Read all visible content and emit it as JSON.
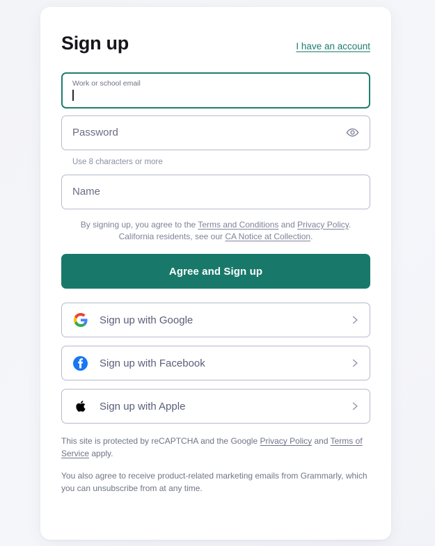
{
  "theme": {
    "accent_green": "#18796b",
    "link_green": "#1d7d6d",
    "page_bg": "#f4f5f9",
    "card_bg": "#ffffff",
    "border": "#b6b9cd",
    "google_red": "#ea4335",
    "google_blue": "#4285f4",
    "google_yellow": "#fbbc05",
    "google_green": "#34a853",
    "facebook_blue": "#1877f2",
    "apple_black": "#000000"
  },
  "header": {
    "title": "Sign up",
    "account_link": "I have an account"
  },
  "form": {
    "email": {
      "label": "Work or school email",
      "value": "",
      "focused": true
    },
    "password": {
      "placeholder": "Password",
      "value": "",
      "helper": "Use 8 characters or more",
      "toggle_icon": "eye-icon"
    },
    "name": {
      "placeholder": "Name",
      "value": ""
    }
  },
  "legal": {
    "line1_pre": "By signing up, you agree to the ",
    "terms_link": "Terms and Conditions",
    "line1_mid": " and ",
    "privacy_link": "Privacy Policy",
    "line1_post": ".",
    "line2_pre": "California residents, see our ",
    "ca_link": "CA Notice at Collection",
    "line2_post": "."
  },
  "cta": {
    "label": "Agree and Sign up"
  },
  "social_buttons": [
    {
      "label": "Sign up with Google",
      "icon": "google-icon",
      "chevron": "chevron-right-icon"
    },
    {
      "label": "Sign up with Facebook",
      "icon": "facebook-icon",
      "chevron": "chevron-right-icon"
    },
    {
      "label": "Sign up with Apple",
      "icon": "apple-icon",
      "chevron": "chevron-right-icon"
    }
  ],
  "fineprint": {
    "recaptcha_pre": "This site is protected by reCAPTCHA and the Google ",
    "recaptcha_privacy": "Privacy Policy",
    "recaptcha_mid": " and ",
    "recaptcha_terms": "Terms of Service",
    "recaptcha_post": " apply.",
    "marketing": "You also agree to receive product-related marketing emails from Grammarly, which you can unsubscribe from at any time."
  }
}
